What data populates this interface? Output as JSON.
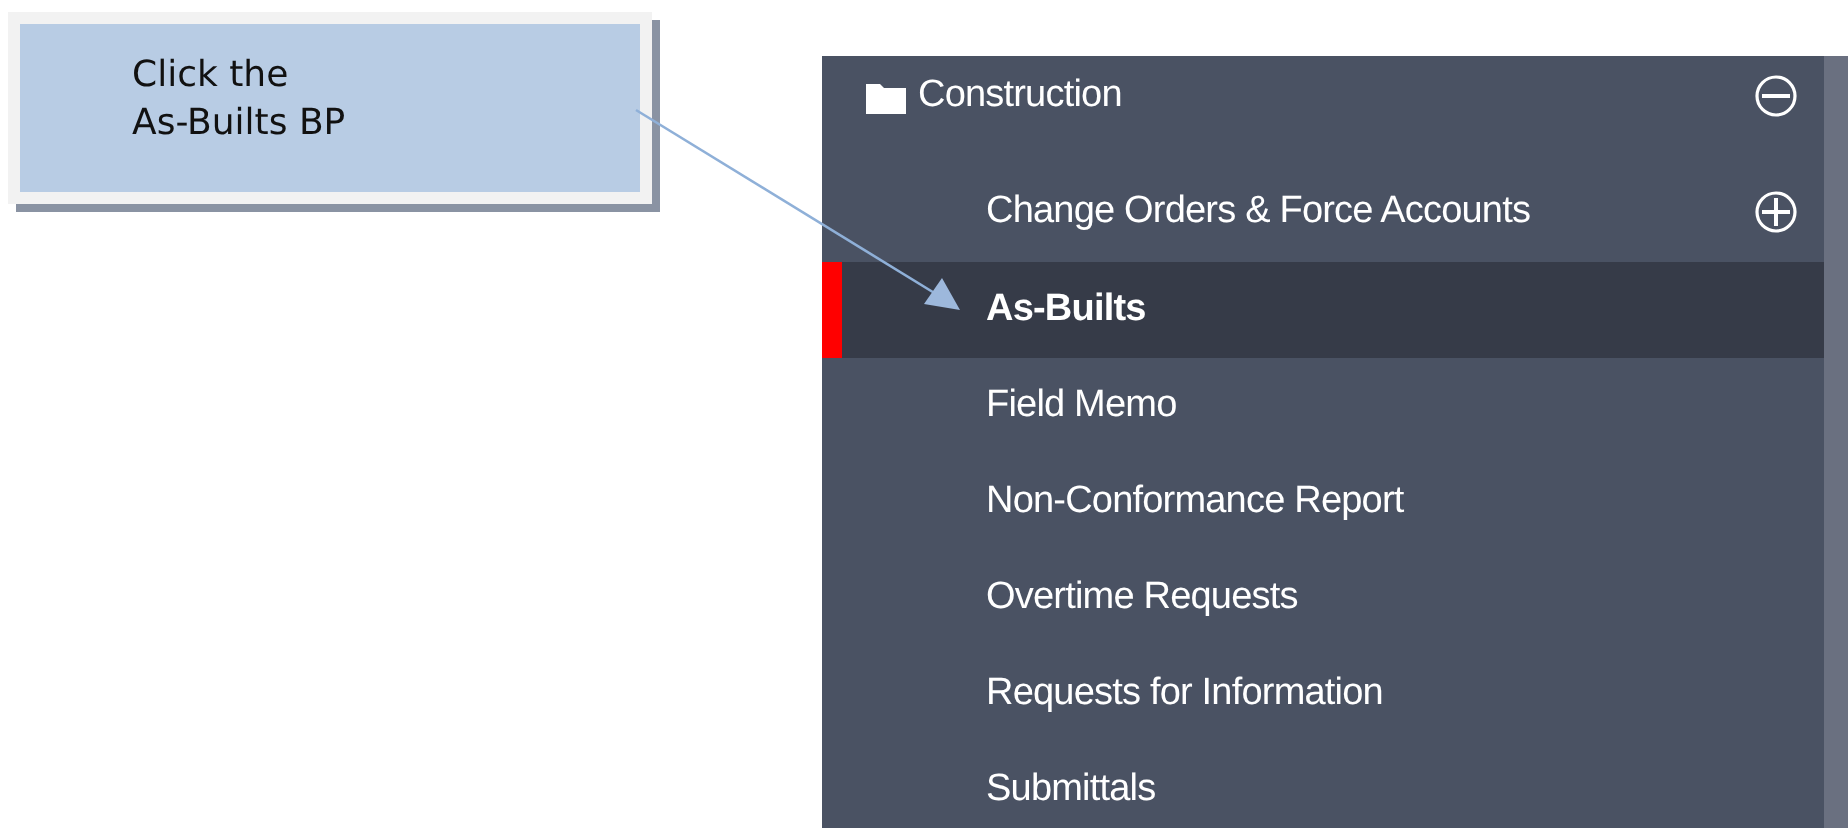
{
  "callout": {
    "lines": [
      "Click the",
      "As-Builts BP"
    ]
  },
  "tree": {
    "label": "Construction",
    "expanded": true,
    "children": [
      {
        "label": "Change Orders & Force Accounts",
        "expanded": false,
        "selected": false
      },
      {
        "label": "As-Builts",
        "selected": true
      },
      {
        "label": "Field Memo",
        "selected": false
      },
      {
        "label": "Non-Conformance Report",
        "selected": false
      },
      {
        "label": "Overtime Requests",
        "selected": false
      },
      {
        "label": "Requests for Information",
        "selected": false
      },
      {
        "label": "Submittals",
        "selected": false
      }
    ]
  }
}
